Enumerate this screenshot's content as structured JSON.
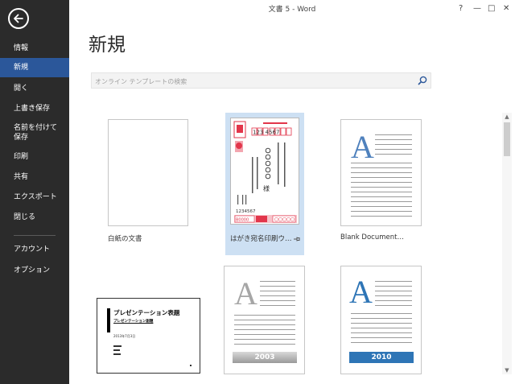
{
  "window": {
    "title": "文書 5 - Word",
    "help": "?",
    "minimize": "—",
    "maximize": "□",
    "close": "✕"
  },
  "sidebar": {
    "items": [
      {
        "label": "情報"
      },
      {
        "label": "新規"
      },
      {
        "label": "開く"
      },
      {
        "label": "上書き保存"
      },
      {
        "label": "名前を付けて保存"
      },
      {
        "label": "印刷"
      },
      {
        "label": "共有"
      },
      {
        "label": "エクスポート"
      },
      {
        "label": "閉じる"
      },
      {
        "label": "アカウント"
      },
      {
        "label": "オプション"
      }
    ],
    "active_index": 1
  },
  "main": {
    "title": "新規",
    "search": {
      "placeholder": "オンライン テンプレートの検索"
    }
  },
  "templates": [
    {
      "label": "白紙の文書"
    },
    {
      "label": "はがき宛名印刷ウ…",
      "preview": {
        "postal_code": "123 4567",
        "recipient_digits": "〇〇〇〇〇",
        "honorific": "様",
        "sender_postal": "1234567",
        "amount_left": "B0000",
        "amount_right": "〇〇〇〇〇"
      }
    },
    {
      "label": "Blank Document…",
      "preview": {
        "letter": "A"
      }
    },
    {
      "label": "",
      "preview": {
        "heading": "プレゼンテーション表題",
        "subheading": "プレゼンテーション副題",
        "date": "2013年7月3日"
      }
    },
    {
      "label": "",
      "preview": {
        "letter": "A",
        "year": "2003"
      }
    },
    {
      "label": "",
      "preview": {
        "letter": "A",
        "year": "2010"
      }
    }
  ],
  "colors": {
    "sidebar_bg": "#2b2b2b",
    "accent": "#2b579a",
    "selected_tile": "#cde0f3",
    "letter_blue": "#4f81bd",
    "letter_gray": "#a6a6a6",
    "postcard_red": "#e2364b"
  }
}
